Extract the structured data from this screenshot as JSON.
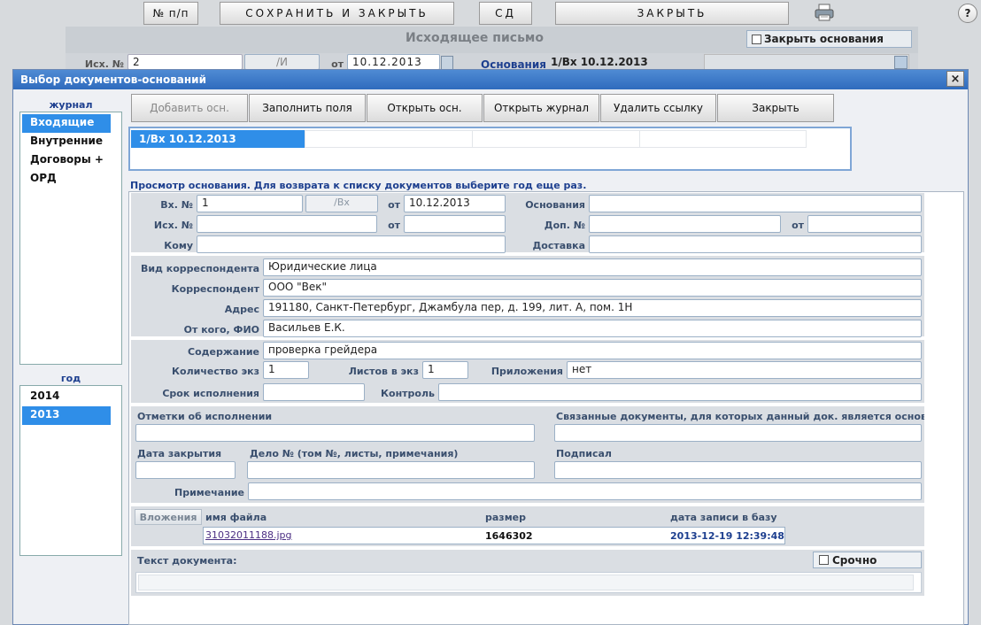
{
  "main": {
    "toolbar": {
      "num_btn": "№ п/п",
      "save_close": "СОХРАНИТЬ И ЗАКРЫТЬ",
      "sd": "СД",
      "close": "ЗАКРЫТЬ",
      "print_icon": "printer-icon",
      "help": "?"
    },
    "title": "Исходящее письмо",
    "close_bases": "Закрыть основания",
    "ish_label": "Исх. №",
    "ish_value": "2",
    "ish_suffix": "/И",
    "ot_label": "от",
    "ot_value": "10.12.2013",
    "osnovaniya_label": "Основания",
    "osnovaniya_value": "1/Вх  10.12.2013"
  },
  "dialog": {
    "title": "Выбор документов-оснований",
    "close": "×",
    "journal_label": "журнал",
    "journals": [
      "Входящие",
      "Внутренние",
      "Договоры +",
      "ОРД"
    ],
    "year_label": "год",
    "years": [
      "2014",
      "2013"
    ],
    "buttons": {
      "add": "Добавить осн.",
      "fill": "Заполнить поля",
      "open": "Открыть осн.",
      "open_journal": "Открыть журнал",
      "delete_link": "Удалить ссылку",
      "close": "Закрыть"
    },
    "list_item": "1/Вх  10.12.2013",
    "hint": "Просмотр основания. Для возврата к списку документов выберите год еще раз.",
    "form": {
      "vx_label": "Вх. №",
      "vx_value": "1",
      "vx_suffix": "/Вх",
      "ot_label": "от",
      "ot_value": "10.12.2013",
      "osn_label": "Основания",
      "ish_label": "Исх. №",
      "ot2_label": "от",
      "dop_label": "Доп. №",
      "ot3_label": "от",
      "komu_label": "Кому",
      "dostavka_label": "Доставка",
      "vid_label": "Вид корреспондента",
      "vid_value": "Юридические лица",
      "korr_label": "Корреспондент",
      "korr_value": "ООО \"Век\"",
      "adres_label": "Адрес",
      "adres_value": "191180, Санкт-Петербург, Джамбула пер, д. 199, лит. А, пом. 1Н",
      "otkogo_label": "От кого, ФИО",
      "otkogo_value": "Васильев Е.К.",
      "sod_label": "Содержание",
      "sod_value": "проверка грейдера",
      "kol_label": "Количество экз",
      "kol_value": "1",
      "list_label": "Листов в экз",
      "list_value": "1",
      "pril_label": "Приложения",
      "pril_value": "нет",
      "srok_label": "Срок исполнения",
      "kontrol_label": "Контроль",
      "otm_label": "Отметки об исполнении",
      "svyaz_label": "Связанные документы, для которых данный док. является основанием",
      "data_zakr_label": "Дата закрытия",
      "delo_label": "Дело № (том №, листы, примечания)",
      "podpisal_label": "Подписал",
      "prim_label": "Примечание",
      "vlozh_label": "Вложения",
      "col_file": "имя файла",
      "col_size": "размер",
      "col_date": "дата записи в базу",
      "file_name": "31032011188.jpg",
      "file_size": "1646302",
      "file_date": "2013-12-19 12:39:48",
      "text_label": "Текст документа:",
      "srochno_label": "Срочно"
    }
  }
}
